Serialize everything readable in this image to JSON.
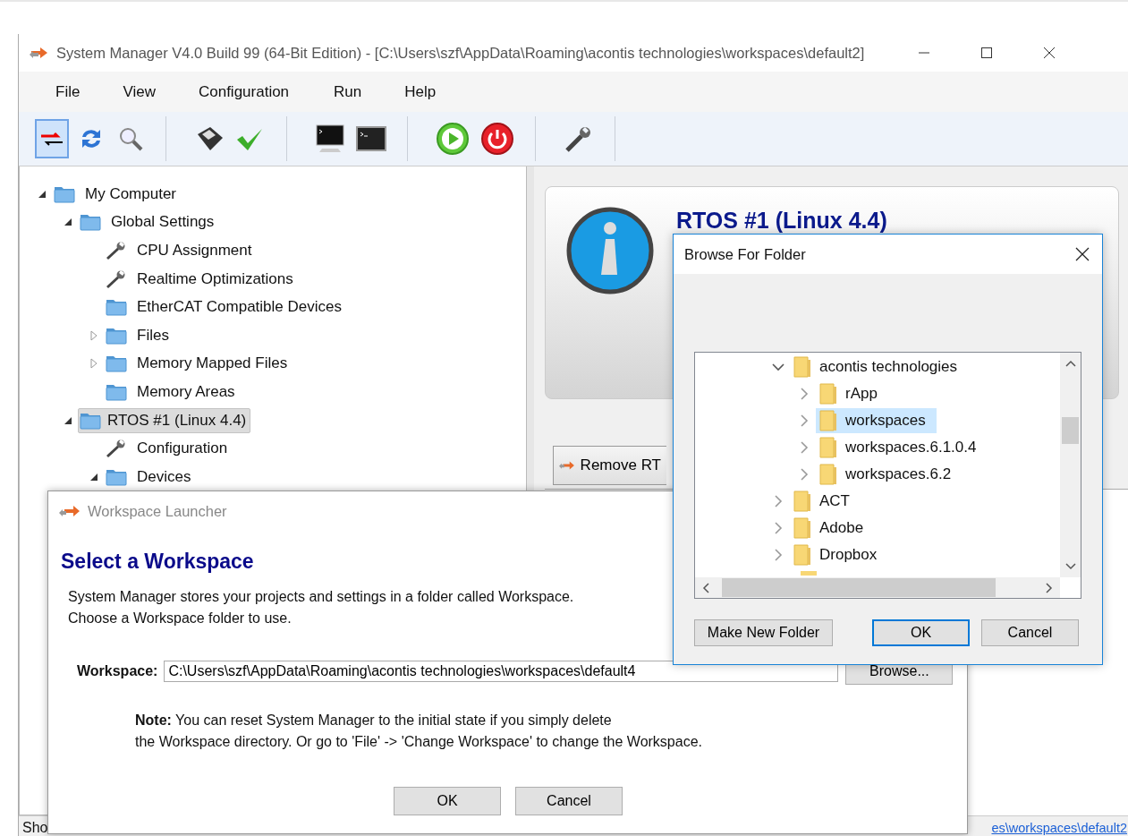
{
  "main_window": {
    "title": "System Manager V4.0 Build 99 (64-Bit Edition) - [C:\\Users\\szf\\AppData\\Roaming\\acontis technologies\\workspaces\\default2]",
    "menu": [
      "File",
      "View",
      "Configuration",
      "Run",
      "Help"
    ],
    "toolbar": [
      {
        "kind": "mode",
        "selected": true
      },
      {
        "kind": "refresh",
        "selected": false
      },
      {
        "kind": "search",
        "selected": false
      },
      {
        "kind": "separator"
      },
      {
        "kind": "save",
        "selected": false
      },
      {
        "kind": "check",
        "selected": false
      },
      {
        "kind": "separator"
      },
      {
        "kind": "monitor",
        "selected": false
      },
      {
        "kind": "terminal",
        "selected": false
      },
      {
        "kind": "separator"
      },
      {
        "kind": "start",
        "selected": false
      },
      {
        "kind": "power",
        "selected": false
      },
      {
        "kind": "separator"
      },
      {
        "kind": "wrench",
        "selected": false
      },
      {
        "kind": "separator"
      }
    ],
    "tree": [
      {
        "label": "My Computer",
        "kind": "folder",
        "expanded": true,
        "selected": false,
        "children": [
          {
            "label": "Global Settings",
            "kind": "folder",
            "expanded": true,
            "selected": false,
            "children": [
              {
                "label": "CPU Assignment",
                "kind": "setting",
                "selected": false
              },
              {
                "label": "Realtime Optimizations",
                "kind": "setting",
                "selected": false
              },
              {
                "label": "EtherCAT Compatible Devices",
                "kind": "folder",
                "selected": false
              },
              {
                "label": "Files",
                "kind": "folder",
                "expanded": false,
                "selected": false
              },
              {
                "label": "Memory Mapped Files",
                "kind": "folder",
                "expanded": false,
                "selected": false
              },
              {
                "label": "Memory Areas",
                "kind": "folder",
                "selected": false
              }
            ]
          },
          {
            "label": "RTOS #1 (Linux 4.4)",
            "kind": "folder",
            "expanded": true,
            "selected": true,
            "children": [
              {
                "label": "Configuration",
                "kind": "setting",
                "selected": false
              },
              {
                "label": "Devices",
                "kind": "folder",
                "expanded": true,
                "selected": false
              }
            ]
          }
        ]
      }
    ],
    "info_card": {
      "title": "RTOS #1 (Linux 4.4)"
    },
    "remove_button": {
      "label": "Remove RT"
    },
    "status_bar": {
      "left": "Sho",
      "right": "es\\workspaces\\default2"
    }
  },
  "workspace_launcher": {
    "title": "Workspace Launcher",
    "heading": "Select a Workspace",
    "description": [
      "System Manager stores your projects and settings in a folder called Workspace.",
      "Choose a Workspace folder to use."
    ],
    "workspace_label": "Workspace:",
    "workspace_value": "C:\\Users\\szf\\AppData\\Roaming\\acontis technologies\\workspaces\\default4",
    "browse_button": "Browse...",
    "note": [
      "**Note:** You can reset System Manager to the initial state if you simply delete",
      "the Workspace directory. Or go to 'File' -> 'Change Workspace' to change the Workspace."
    ],
    "buttons": [
      "OK",
      "Cancel"
    ]
  },
  "browse_dialog": {
    "title": "Browse For Folder",
    "tree": [
      {
        "label": "acontis technologies",
        "expanded": true,
        "selected": false,
        "children": [
          {
            "label": "rApp",
            "expanded": false,
            "selected": false
          },
          {
            "label": "workspaces",
            "expanded": false,
            "selected": true
          },
          {
            "label": "workspaces.6.1.0.4",
            "expanded": false,
            "selected": false
          },
          {
            "label": "workspaces.6.2",
            "expanded": false,
            "selected": false
          }
        ]
      },
      {
        "label": "ACT",
        "expanded": false,
        "selected": false
      },
      {
        "label": "Adobe",
        "expanded": false,
        "selected": false
      },
      {
        "label": "Dropbox",
        "expanded": false,
        "selected": false
      }
    ],
    "buttons": [
      {
        "label": "Make New Folder",
        "default": false
      },
      {
        "label": "OK",
        "default": true
      },
      {
        "label": "Cancel",
        "default": false
      }
    ]
  }
}
